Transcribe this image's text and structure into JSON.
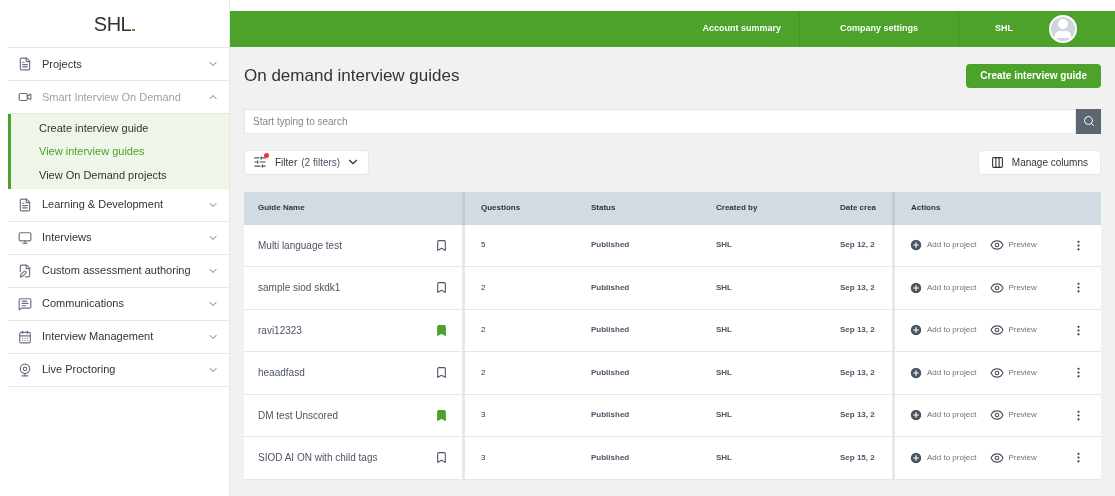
{
  "logo": "SHL",
  "sidebar": {
    "items": [
      {
        "label": "Projects",
        "expanded": false
      },
      {
        "label": "Smart Interview On Demand",
        "expanded": true,
        "children": [
          {
            "label": "Create interview guide",
            "selected": false
          },
          {
            "label": "View interview guides",
            "selected": true
          },
          {
            "label": "View On Demand projects",
            "selected": false
          }
        ]
      },
      {
        "label": "Learning & Development",
        "expanded": false
      },
      {
        "label": "Interviews",
        "expanded": false
      },
      {
        "label": "Custom assessment authoring",
        "expanded": false
      },
      {
        "label": "Communications",
        "expanded": false
      },
      {
        "label": "Interview Management",
        "expanded": false
      },
      {
        "label": "Live Proctoring",
        "expanded": false
      }
    ]
  },
  "topbar": {
    "links": [
      "Account summary",
      "Company settings",
      "SHL"
    ]
  },
  "page": {
    "title": "On demand interview guides",
    "create_button": "Create interview guide",
    "search": {
      "placeholder": "Start typing to search"
    },
    "filter": {
      "label": "Filter",
      "count": "(2 filters)",
      "active": true
    },
    "manage_columns": "Manage columns"
  },
  "table": {
    "columns": [
      "Guide Name",
      "Questions",
      "Status",
      "Created by",
      "Date crea",
      "Actions"
    ],
    "rows": [
      {
        "name": "Multi language test",
        "bookmarked": false,
        "questions": "5",
        "status": "Published",
        "created_by": "SHL",
        "date": "Sep 12, 2",
        "add": "Add to project",
        "preview": "Preview"
      },
      {
        "name": "sample siod skdk1",
        "bookmarked": false,
        "questions": "2",
        "status": "Published",
        "created_by": "SHL",
        "date": "Sep 13, 2",
        "add": "Add to project",
        "preview": "Preview"
      },
      {
        "name": "ravi12323",
        "bookmarked": true,
        "questions": "2",
        "status": "Published",
        "created_by": "SHL",
        "date": "Sep 13, 2",
        "add": "Add to project",
        "preview": "Preview"
      },
      {
        "name": "heaadfasd",
        "bookmarked": false,
        "questions": "2",
        "status": "Published",
        "created_by": "SHL",
        "date": "Sep 13, 2",
        "add": "Add to project",
        "preview": "Preview"
      },
      {
        "name": "DM test Unscored",
        "bookmarked": true,
        "questions": "3",
        "status": "Published",
        "created_by": "SHL",
        "date": "Sep 13, 2",
        "add": "Add to project",
        "preview": "Preview"
      },
      {
        "name": "SIOD AI ON with child tags",
        "bookmarked": false,
        "questions": "3",
        "status": "Published",
        "created_by": "SHL",
        "date": "Sep 15, 2",
        "add": "Add to project",
        "preview": "Preview"
      }
    ]
  }
}
